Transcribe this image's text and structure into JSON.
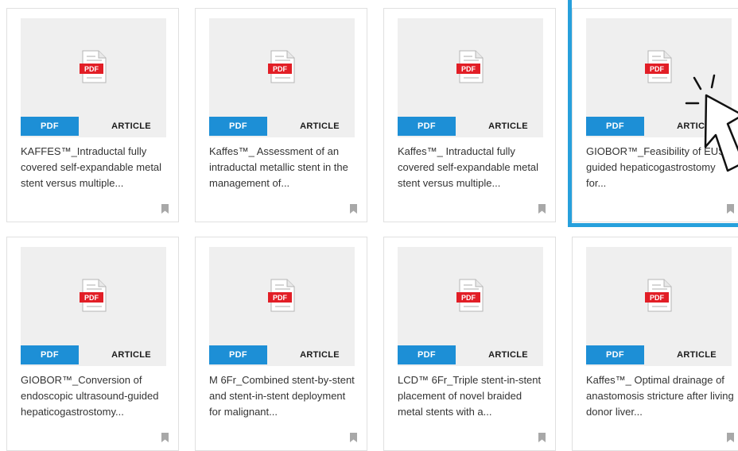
{
  "colors": {
    "accent": "#1d8fd6",
    "highlight_border": "#27a0dc",
    "pdf_red": "#e21e26"
  },
  "cards": [
    {
      "icon": "pdf-file-icon",
      "pdf_icon_label": "PDF",
      "pdf_tag": "PDF",
      "type_tag": "ARTICLE",
      "title": "KAFFES™_Intraductal fully covered self-expandable metal stent versus multiple...",
      "bookmark": "bookmark-icon"
    },
    {
      "icon": "pdf-file-icon",
      "pdf_icon_label": "PDF",
      "pdf_tag": "PDF",
      "type_tag": "ARTICLE",
      "title": "Kaffes™_ Assessment of an intraductal metallic stent in the management of...",
      "bookmark": "bookmark-icon"
    },
    {
      "icon": "pdf-file-icon",
      "pdf_icon_label": "PDF",
      "pdf_tag": "PDF",
      "type_tag": "ARTICLE",
      "title": "Kaffes™_ Intraductal fully covered self-expandable metal stent versus multiple...",
      "bookmark": "bookmark-icon"
    },
    {
      "icon": "pdf-file-icon",
      "pdf_icon_label": "PDF",
      "pdf_tag": "PDF",
      "type_tag": "ARTICLE",
      "title": "GIOBOR™_Feasibility of EUS-guided hepaticogastrostomy for...",
      "bookmark": "bookmark-icon"
    },
    {
      "icon": "pdf-file-icon",
      "pdf_icon_label": "PDF",
      "pdf_tag": "PDF",
      "type_tag": "ARTICLE",
      "title": "GIOBOR™_Conversion of endoscopic ultrasound-guided hepaticogastrostomy...",
      "bookmark": "bookmark-icon"
    },
    {
      "icon": "pdf-file-icon",
      "pdf_icon_label": "PDF",
      "pdf_tag": "PDF",
      "type_tag": "ARTICLE",
      "title": "M 6Fr_Combined stent-by-stent and stent-in-stent deployment for malignant...",
      "bookmark": "bookmark-icon"
    },
    {
      "icon": "pdf-file-icon",
      "pdf_icon_label": "PDF",
      "pdf_tag": "PDF",
      "type_tag": "ARTICLE",
      "title": "LCD™ 6Fr_Triple stent-in-stent placement of novel braided metal stents with a...",
      "bookmark": "bookmark-icon"
    },
    {
      "icon": "pdf-file-icon",
      "pdf_icon_label": "PDF",
      "pdf_tag": "PDF",
      "type_tag": "ARTICLE",
      "title": "Kaffes™_ Optimal drainage of anastomosis stricture after living donor liver...",
      "bookmark": "bookmark-icon"
    }
  ],
  "overlay": {
    "highlighted_card": 4,
    "cursor_icon": "pointer-cursor-icon"
  }
}
